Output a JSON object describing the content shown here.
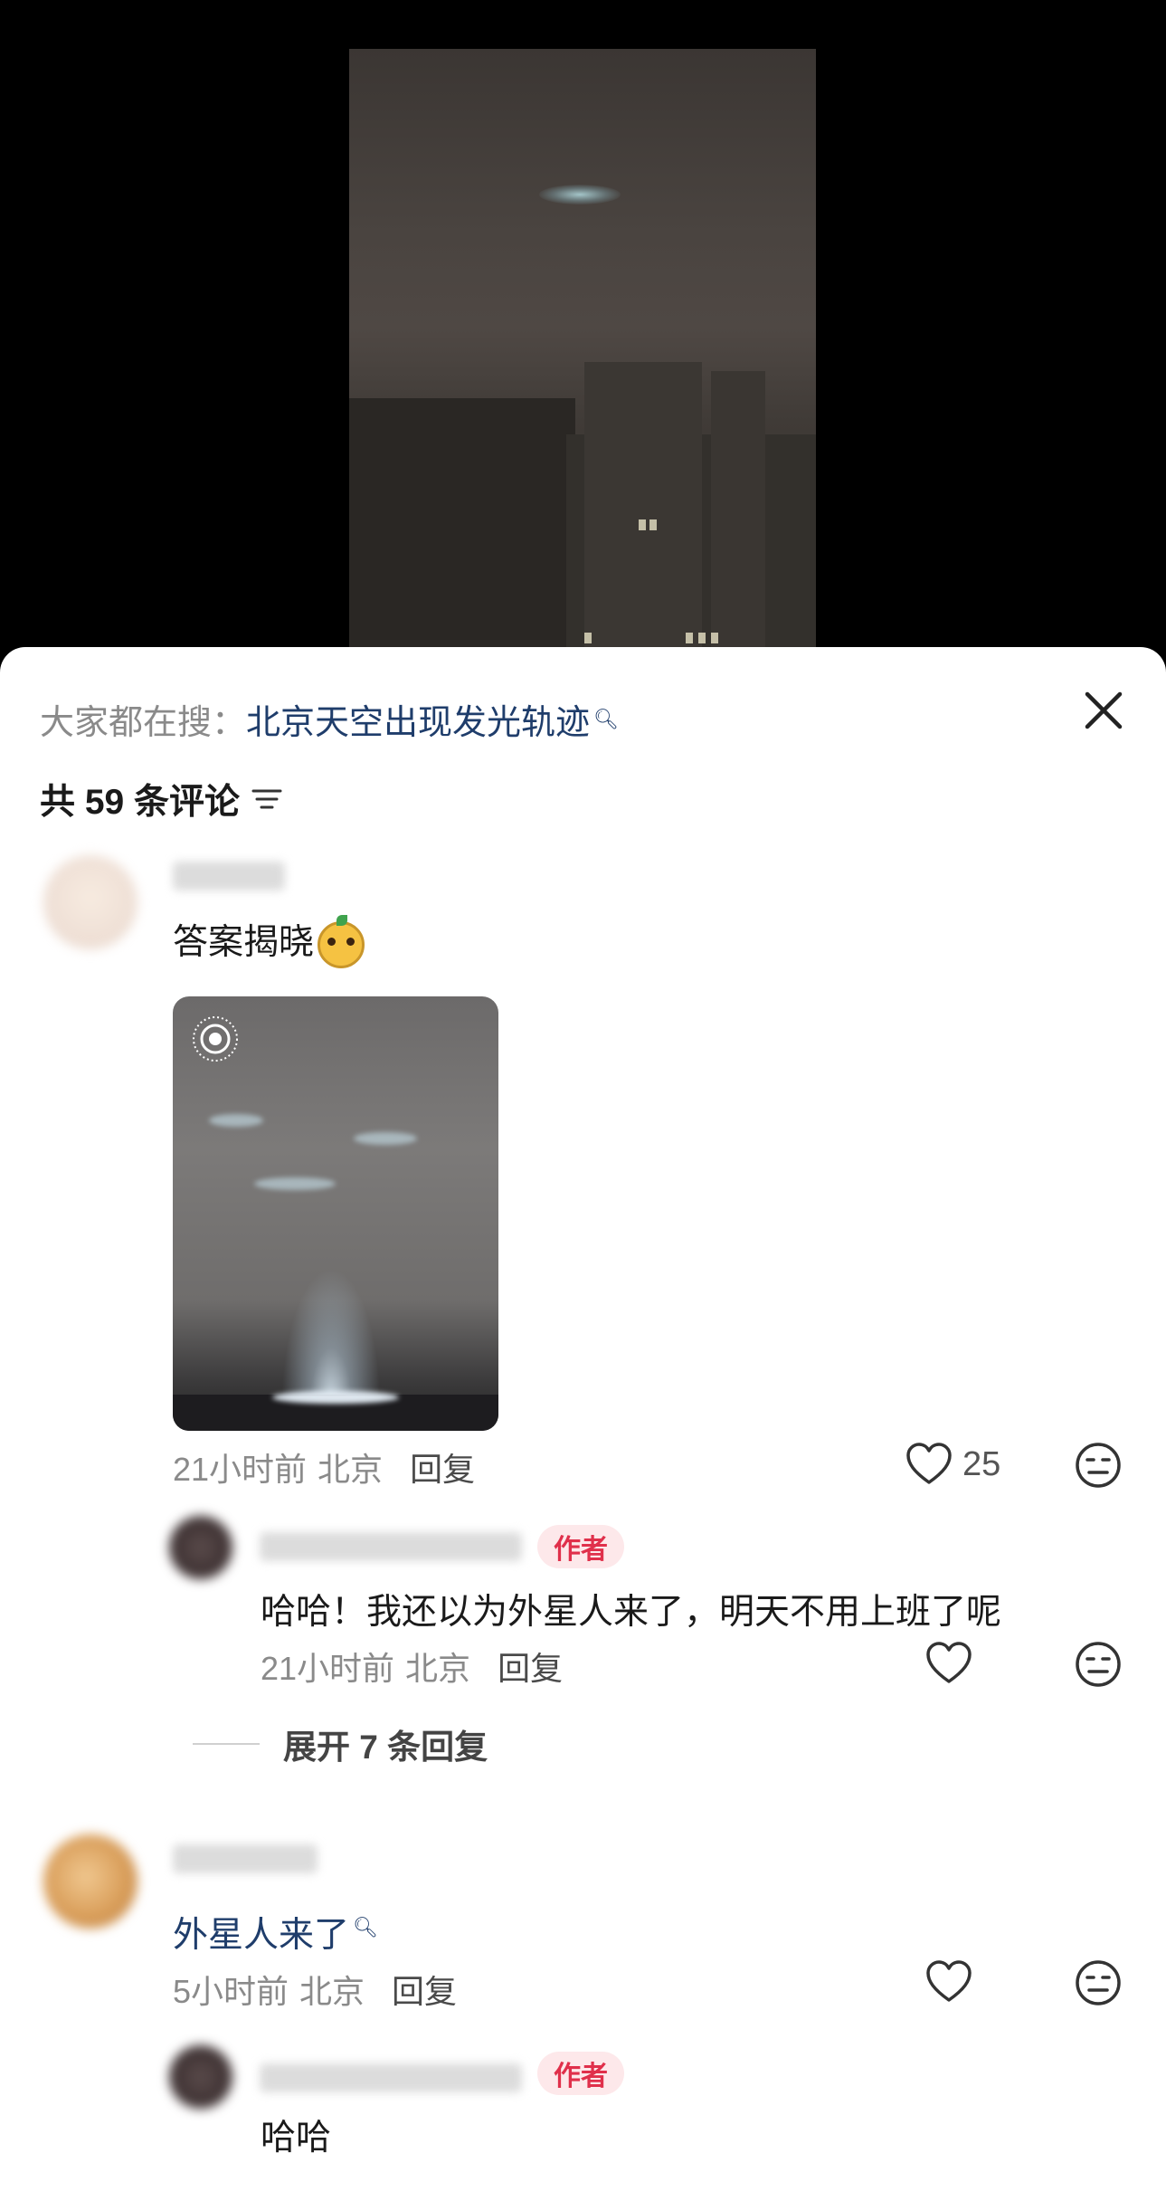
{
  "search_bar": {
    "prefix": "大家都在搜：",
    "term": "北京天空出现发光轨迹",
    "search_icon": "search-icon"
  },
  "comments_header": {
    "count_text": "共 59 条评论",
    "sort_icon": "sort-icon"
  },
  "comments": [
    {
      "text": "答案揭晓",
      "has_emoji": true,
      "has_image": true,
      "image_badge": "live-photo-icon",
      "time": "21小时前",
      "location": "北京",
      "reply_label": "回复",
      "likes": "25",
      "replies": [
        {
          "badge": "作者",
          "text": "哈哈！我还以为外星人来了，明天不用上班了呢",
          "time": "21小时前",
          "location": "北京",
          "reply_label": "回复"
        }
      ],
      "expand_label": "展开 7 条回复"
    },
    {
      "text": "外星人来了",
      "is_search_link": true,
      "time": "5小时前",
      "location": "北京",
      "reply_label": "回复",
      "replies": [
        {
          "badge": "作者",
          "text": "哈哈"
        }
      ]
    }
  ],
  "colors": {
    "link": "#1f3d6b",
    "author_badge_bg": "#fde8ea",
    "author_badge_text": "#e0304b",
    "meta_text": "#8a8a8a"
  }
}
